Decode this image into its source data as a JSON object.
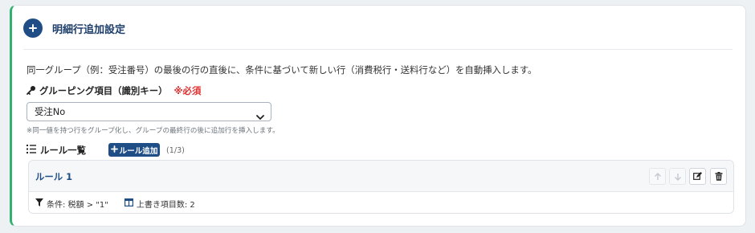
{
  "header": {
    "title": "明細行追加設定"
  },
  "description": "同一グループ（例：受注番号）の最後の行の直後に、条件に基づいて新しい行（消費税行・送料行など）を自動挿入します。",
  "grouping": {
    "label": "グルーピング項目（識別キー）",
    "required": "※必須",
    "selected": "受注No",
    "help": "※同一値を持つ行をグループ化し、グループの最終行の後に追加行を挿入します。"
  },
  "rules": {
    "title": "ルール一覧",
    "add_label": "ルール追加",
    "count": "(1/3)",
    "items": [
      {
        "name": "ルール 1",
        "condition": "条件: 税額 > \"1\"",
        "overwrite": "上書き項目数: 2"
      }
    ]
  },
  "colors": {
    "accent": "#1f4e87",
    "border_accent": "#2fb36c",
    "required": "#e03131"
  },
  "icons": [
    "plus-circle-icon",
    "key-icon",
    "list-icon",
    "plus-icon",
    "arrow-up-icon",
    "arrow-down-icon",
    "edit-icon",
    "trash-icon",
    "filter-icon",
    "columns-icon",
    "chevron-down-icon"
  ]
}
